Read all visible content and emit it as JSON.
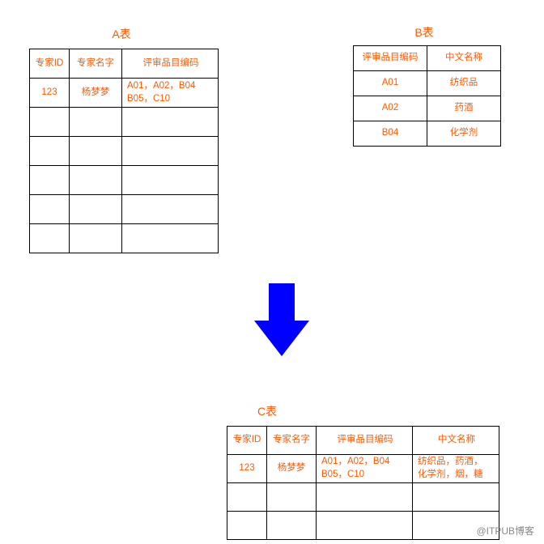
{
  "colors": {
    "accent": "#ff5a00",
    "arrow": "#0000ff"
  },
  "titles": {
    "a": "A表",
    "b": "B表",
    "c": "C表"
  },
  "tableA": {
    "headers": [
      "专家ID",
      "专家名字",
      "评审品目编码"
    ],
    "rows": [
      {
        "id": "123",
        "name": "杨梦梦",
        "codes": "A01，A02，B04\nB05，C10"
      },
      {
        "id": "",
        "name": "",
        "codes": ""
      },
      {
        "id": "",
        "name": "",
        "codes": ""
      },
      {
        "id": "",
        "name": "",
        "codes": ""
      },
      {
        "id": "",
        "name": "",
        "codes": ""
      },
      {
        "id": "",
        "name": "",
        "codes": ""
      }
    ]
  },
  "tableB": {
    "headers": [
      "评审品目编码",
      "中文名称"
    ],
    "rows": [
      {
        "code": "A01",
        "name": "纺织品"
      },
      {
        "code": "A02",
        "name": "药酒"
      },
      {
        "code": "B04",
        "name": "化学剂"
      }
    ]
  },
  "tableC": {
    "headers": [
      "专家ID",
      "专家名字",
      "评审品目编码",
      "中文名称"
    ],
    "rows": [
      {
        "id": "123",
        "name": "杨梦梦",
        "codes": "A01，A02，B04\nB05，C10",
        "cn": "纺织品，药酒，\n化学剂，烟，糖"
      },
      {
        "id": "",
        "name": "",
        "codes": "",
        "cn": ""
      },
      {
        "id": "",
        "name": "",
        "codes": "",
        "cn": ""
      }
    ]
  },
  "watermark": "@ITPUB博客"
}
